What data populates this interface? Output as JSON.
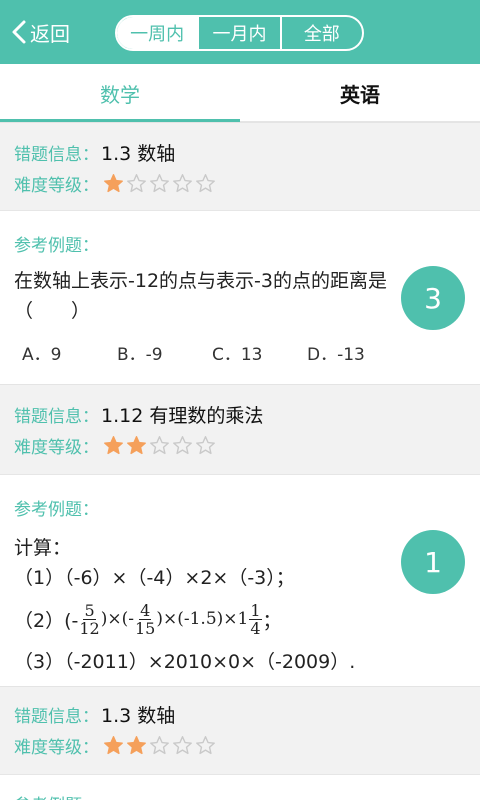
{
  "colors": {
    "accent": "#4fc0ad",
    "star_filled": "#f5a05b",
    "star_empty": "#c9c9c9"
  },
  "header": {
    "back_label": "返回",
    "segments": [
      "一周内",
      "一月内",
      "全部"
    ],
    "selected_segment": "一周内"
  },
  "subject_tabs": [
    "数学",
    "英语"
  ],
  "labels": {
    "error_info": "错题信息：",
    "difficulty": "难度等级：",
    "reference": "参考例题："
  },
  "items": [
    {
      "topic": "1.3 数轴",
      "difficulty_stars": 1,
      "question": "在数轴上表示-12的点与表示-3的点的距离是（　　）",
      "options": [
        "A．9",
        "B．-9",
        "C．13",
        "D．-13"
      ],
      "count": "3"
    },
    {
      "topic": "1.12 有理数的乘法",
      "difficulty_stars": 2,
      "question_intro": "计算：",
      "lines": {
        "l1": "（1）（-6）×（-4）×2×（-3）；",
        "l2_start": "（2）(-",
        "l2_mid1": ")×(-",
        "l2_mid2": ")×(-1.5)×1",
        "l2_end": "；",
        "l3": "（3）（-2011）×2010×0×（-2009）."
      },
      "fractions": {
        "f1_num": "5",
        "f1_den": "12",
        "f2_num": "4",
        "f2_den": "15",
        "f3_num": "1",
        "f3_den": "4"
      },
      "count": "1"
    },
    {
      "topic": "1.3 数轴",
      "difficulty_stars": 2
    }
  ]
}
